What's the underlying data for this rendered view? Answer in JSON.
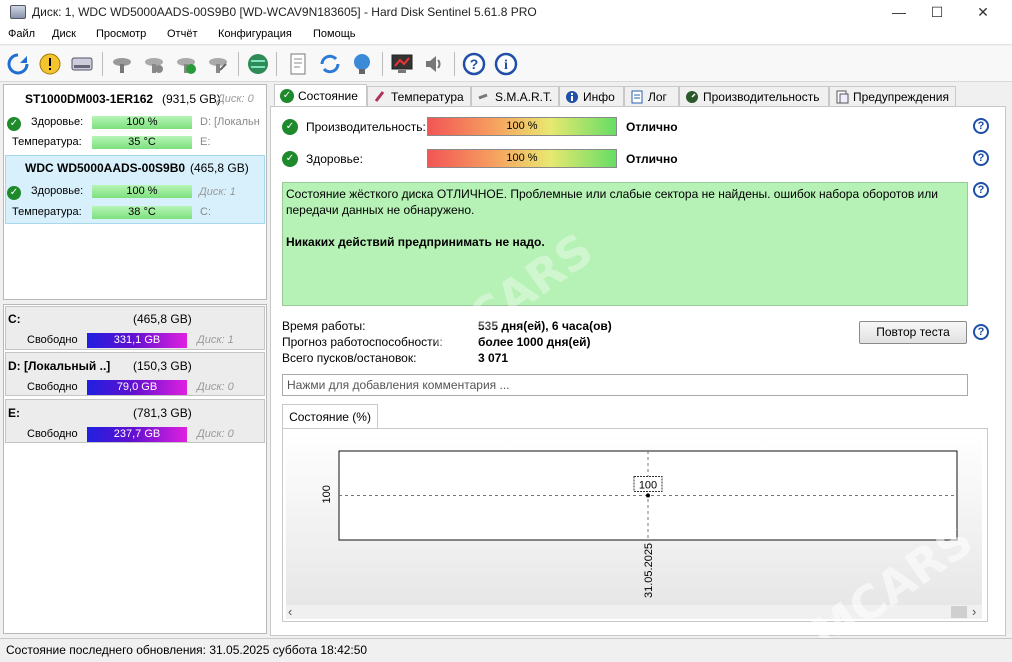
{
  "window": {
    "title": "Диск: 1, WDC WD5000AADS-00S9B0 [WD-WCAV9N183605]  -  Hard Disk Sentinel 5.61.8 PRO",
    "minimize": "—",
    "maximize": "☐",
    "close": "✕"
  },
  "menu": [
    "Файл",
    "Диск",
    "Просмотр",
    "Отчёт",
    "Конфигурация",
    "Помощь"
  ],
  "disks": [
    {
      "name": "ST1000DM003-1ER162",
      "size": "(931,5 GB)",
      "disk_index": "Диск: 0",
      "health_label": "Здоровье:",
      "health_value": "100 %",
      "health_pct": 100,
      "health_extra": "D: [Локальн",
      "temp_label": "Температура:",
      "temp_value": "35 °C",
      "temp_extra": "E:"
    },
    {
      "name": "WDC WD5000AADS-00S9B0",
      "size": "(465,8 GB)",
      "disk_index": "Диск: 1",
      "health_label": "Здоровье:",
      "health_value": "100 %",
      "health_pct": 100,
      "temp_label": "Температура:",
      "temp_value": "38 °C",
      "temp_extra": "C:"
    }
  ],
  "volumes": [
    {
      "name": "C:",
      "size": "(465,8 GB)",
      "free_label": "Свободно",
      "free_value": "331,1 GB",
      "disk": "Диск: 1"
    },
    {
      "name": "D: [Локальный ..]",
      "size": "(150,3 GB)",
      "free_label": "Свободно",
      "free_value": "79,0 GB",
      "disk": "Диск: 0"
    },
    {
      "name": "E:",
      "size": "(781,3 GB)",
      "free_label": "Свободно",
      "free_value": "237,7 GB",
      "disk": "Диск: 0"
    }
  ],
  "tabs": [
    "Состояние",
    "Температура",
    "S.M.A.R.T.",
    "Инфо",
    "Лог",
    "Производительность",
    "Предупреждения"
  ],
  "status": {
    "performance_label": "Производительность:",
    "performance_value": "100 %",
    "performance_pct": 100,
    "performance_rating": "Отлично",
    "health_label": "Здоровье:",
    "health_value": "100 %",
    "health_pct": 100,
    "health_rating": "Отлично",
    "message": "Состояние жёсткого диска ОТЛИЧНОЕ. Проблемные или слабые сектора не найдены. ошибок набора оборотов или передачи данных не обнаружено.",
    "action": "Никаких действий предпринимать не надо.",
    "uptime_label": "Время работы:",
    "uptime_value": "535 дня(ей), 6 часа(ов)",
    "forecast_label": "Прогноз работоспособности:",
    "forecast_value": "более 1000 дня(ей)",
    "starts_label": "Всего пусков/остановок:",
    "starts_value": "3 071",
    "retest_button": "Повтор теста",
    "comment_placeholder": "Нажми для добавления комментария ..."
  },
  "chart_tab": "Состояние (%)",
  "chart_data": {
    "type": "line",
    "x": [
      "31.05.2025"
    ],
    "series": [
      {
        "values": [
          100
        ]
      }
    ],
    "point_label": "100",
    "ytick": "100",
    "xtick": "31.05.2025"
  },
  "statusbar": "Состояние последнего обновления: 31.05.2025 суббота 18:42:50",
  "help_glyph": "?",
  "check_glyph": "✓",
  "scroll_left": "‹",
  "scroll_right": "›"
}
